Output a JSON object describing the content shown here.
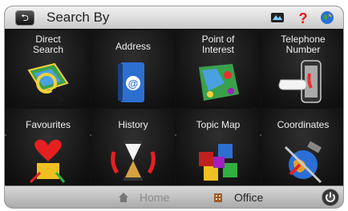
{
  "header": {
    "title": "Search By",
    "back_icon": "back-arrow-icon"
  },
  "top_icons": [
    "map-icon",
    "help-icon",
    "globe-icon"
  ],
  "tiles": [
    {
      "label": "Direct\nSearch",
      "icon": "map-magnifier-icon"
    },
    {
      "label": "Address",
      "icon": "address-book-icon"
    },
    {
      "label": "Point of\nInterest",
      "icon": "poi-map-icon"
    },
    {
      "label": "Telephone\nNumber",
      "icon": "phone-hand-icon"
    },
    {
      "label": "Favourites",
      "icon": "heart-icon"
    },
    {
      "label": "History",
      "icon": "hourglass-icon"
    },
    {
      "label": "Topic Map",
      "icon": "topic-cubes-icon"
    },
    {
      "label": "Coordinates",
      "icon": "satellite-globe-icon"
    }
  ],
  "footer": {
    "home_label": "Home",
    "office_label": "Office",
    "power_icon": "power-icon"
  }
}
